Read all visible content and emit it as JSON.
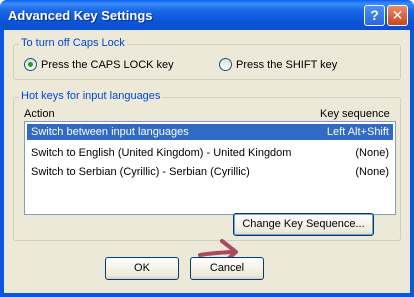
{
  "window": {
    "title": "Advanced Key Settings",
    "help_label": "?",
    "close_label": "✕"
  },
  "caps_lock": {
    "caption": "To turn off Caps Lock",
    "options": [
      {
        "label": "Press the CAPS LOCK key",
        "selected": true
      },
      {
        "label": "Press the SHIFT key",
        "selected": false
      }
    ]
  },
  "hotkeys": {
    "caption": "Hot keys for input languages",
    "col_action": "Action",
    "col_key_sequence": "Key sequence",
    "rows": [
      {
        "action": "Switch between input languages",
        "key_sequence": "Left Alt+Shift",
        "selected": true
      },
      {
        "action": "Switch to English (United Kingdom) - United Kingdom",
        "key_sequence": "(None)",
        "selected": false
      },
      {
        "action": "Switch to Serbian (Cyrillic) - Serbian (Cyrillic)",
        "key_sequence": "(None)",
        "selected": false
      }
    ],
    "change_button": "Change Key Sequence..."
  },
  "buttons": {
    "ok": "OK",
    "cancel": "Cancel"
  },
  "colors": {
    "titlebar": "#0a56e0",
    "caption_text": "#0046d5",
    "selection": "#316ac5",
    "annotation_arrow": "#a94a61"
  },
  "annotation": {
    "icon": "arrow-right-icon"
  }
}
